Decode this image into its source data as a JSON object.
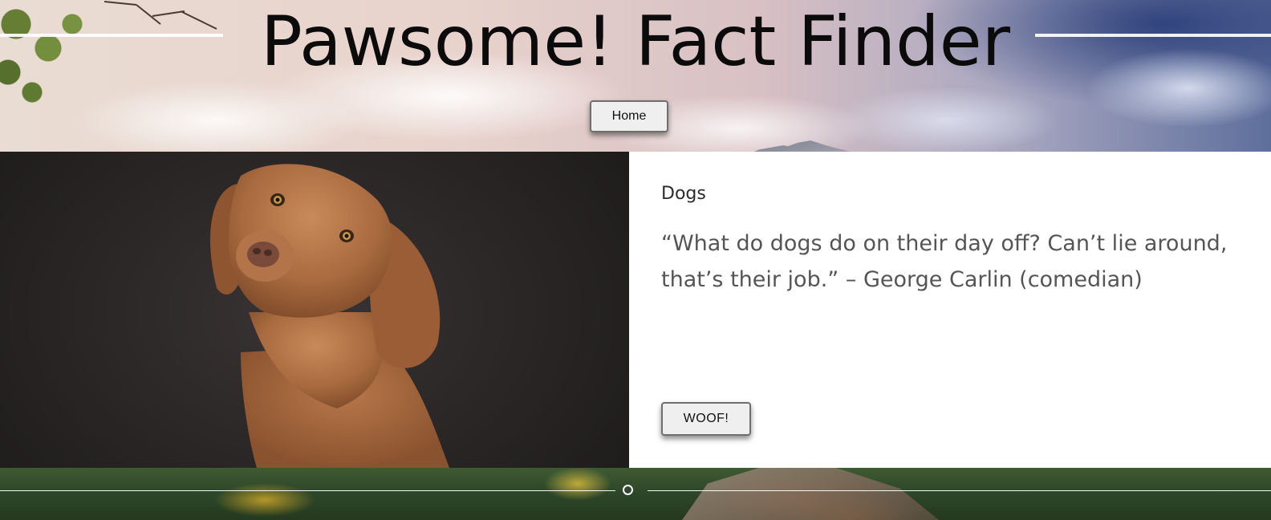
{
  "header": {
    "title": "Pawsome! Fact Finder",
    "home_button_label": "Home"
  },
  "card": {
    "image_icon": "dog-photo",
    "heading": "Dogs",
    "quote": "“What do dogs do on their day off? Can’t lie around, that’s their job.” – George Carlin (comedian)",
    "action_button_label": "WOOF!"
  },
  "colors": {
    "title_text": "#0b0b0b",
    "heading_text": "#2b2b2b",
    "quote_text": "#555555",
    "button_bg": "#efefef",
    "button_border": "#6f6f6f",
    "panel_bg": "#ffffff",
    "photo_bg": "#2a2626"
  }
}
